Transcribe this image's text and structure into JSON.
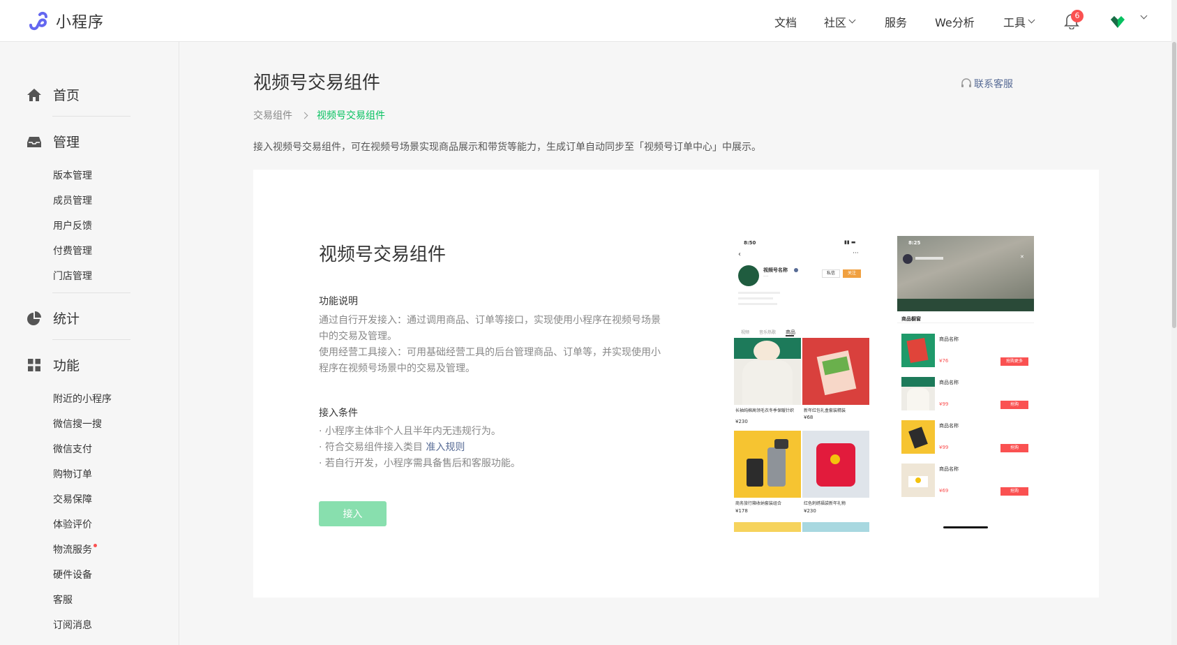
{
  "header": {
    "logo_text": "小程序",
    "nav": [
      {
        "label": "文档",
        "dropdown": false
      },
      {
        "label": "社区",
        "dropdown": true
      },
      {
        "label": "服务",
        "dropdown": false
      },
      {
        "label": "We分析",
        "dropdown": false
      },
      {
        "label": "工具",
        "dropdown": true
      }
    ],
    "notification_count": "6"
  },
  "sidebar": {
    "sections": [
      {
        "label": "首页",
        "icon": "home-icon"
      },
      {
        "label": "管理",
        "icon": "inbox-icon",
        "items": [
          "版本管理",
          "成员管理",
          "用户反馈",
          "付费管理",
          "门店管理"
        ]
      },
      {
        "label": "统计",
        "icon": "pie-chart-icon"
      },
      {
        "label": "功能",
        "icon": "grid-icon",
        "items": [
          "附近的小程序",
          "微信搜一搜",
          "微信支付",
          "购物订单",
          "交易保障",
          "体验评价",
          "物流服务",
          "硬件设备",
          "客服",
          "订阅消息"
        ]
      }
    ]
  },
  "main": {
    "title": "视频号交易组件",
    "contact": "联系客服",
    "breadcrumb": [
      "交易组件",
      "视频号交易组件"
    ],
    "description": "接入视频号交易组件，可在视频号场景实现商品展示和带货等能力，生成订单自动同步至「视频号订单中心」中展示。",
    "card": {
      "title": "视频号交易组件",
      "feature_heading": "功能说明",
      "feature_lines": [
        "通过自行开发接入：通过调用商品、订单等接口，实现使用小程序在视频号场景中的交易及管理。",
        "使用经营工具接入：可用基础经营工具的后台管理商品、订单等，并实现使用小程序在视频号场景中的交易及管理。"
      ],
      "condition_heading": "接入条件",
      "conditions": [
        "· 小程序主体非个人且半年内无违规行为。",
        "· 符合交易组件接入类目 ",
        "· 若自行开发，小程序需具备售后和客服功能。"
      ],
      "rule_link": "准入规则",
      "button": "接入"
    },
    "phone1": {
      "time": "8:50",
      "channel_name": "视频号名称",
      "follow": "关注",
      "message": "私信",
      "tabs": [
        "视频",
        "音乐热歌",
        "商品"
      ],
      "products": [
        {
          "name": "长袖纯棉高领毛衣冬季保暖针织",
          "price": "¥230"
        },
        {
          "name": "新年红包礼盒套装精装",
          "price": "¥68"
        },
        {
          "name": "商务旅行箱收纳套装组合",
          "price": "¥178"
        },
        {
          "name": "红色刺绣福袋新年礼物",
          "price": "¥230"
        }
      ]
    },
    "phone2": {
      "time": "8:25",
      "header": "商品橱窗",
      "items": [
        {
          "name": "商品名称",
          "price": "¥76",
          "button": "抢购更多"
        },
        {
          "name": "商品名称",
          "price": "¥99",
          "button": "抢购"
        },
        {
          "name": "商品名称",
          "price": "¥99",
          "button": "抢购"
        },
        {
          "name": "商品名称",
          "price": "¥69",
          "button": "抢购"
        }
      ]
    }
  },
  "colors": {
    "brand_green": "#07c160",
    "button_disabled": "#88dfae",
    "link_blue": "#576b95",
    "badge_red": "#fa5151"
  }
}
